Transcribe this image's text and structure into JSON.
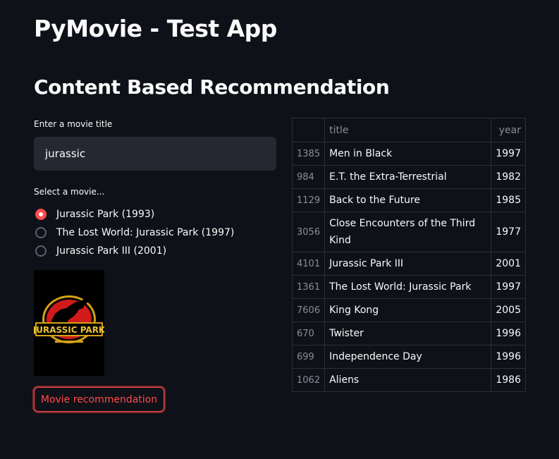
{
  "header": {
    "title": "PyMovie - Test App",
    "section_title": "Content Based Recommendation"
  },
  "search": {
    "label": "Enter a movie title",
    "value": "jurassic"
  },
  "movie_select": {
    "label": "Select a movie...",
    "options": [
      {
        "label": "Jurassic Park (1993)",
        "selected": true
      },
      {
        "label": "The Lost World: Jurassic Park (1997)",
        "selected": false
      },
      {
        "label": "Jurassic Park III (2001)",
        "selected": false
      }
    ]
  },
  "poster": {
    "logo_text": "JURASSIC PARK"
  },
  "button": {
    "label": "Movie recommendation"
  },
  "colors": {
    "background": "#0e1117",
    "accent": "#ff4b4b",
    "input_bg": "#262730"
  },
  "table": {
    "columns": [
      "",
      "title",
      "year"
    ],
    "rows": [
      {
        "index": "1385",
        "title": "Men in Black",
        "year": "1997"
      },
      {
        "index": "984",
        "title": "E.T. the Extra-Terrestrial",
        "year": "1982"
      },
      {
        "index": "1129",
        "title": "Back to the Future",
        "year": "1985"
      },
      {
        "index": "3056",
        "title": "Close Encounters of the Third Kind",
        "year": "1977"
      },
      {
        "index": "4101",
        "title": "Jurassic Park III",
        "year": "2001"
      },
      {
        "index": "1361",
        "title": "The Lost World: Jurassic Park",
        "year": "1997"
      },
      {
        "index": "7606",
        "title": "King Kong",
        "year": "2005"
      },
      {
        "index": "670",
        "title": "Twister",
        "year": "1996"
      },
      {
        "index": "699",
        "title": "Independence Day",
        "year": "1996"
      },
      {
        "index": "1062",
        "title": "Aliens",
        "year": "1986"
      }
    ]
  }
}
